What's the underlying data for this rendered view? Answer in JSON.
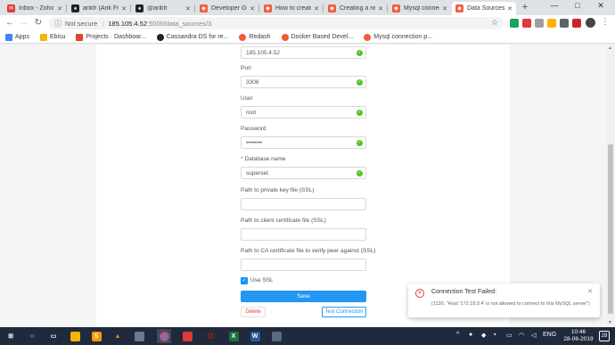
{
  "browser": {
    "tabs": [
      {
        "title": "Inbox - Zoho M",
        "icon": "mail-icon",
        "color": "#e0393b"
      },
      {
        "title": "arikfr (Arik Fra",
        "icon": "github-icon",
        "color": "#222222"
      },
      {
        "title": "@arikfr",
        "icon": "github-icon",
        "color": "#222222"
      },
      {
        "title": "Developer Gui",
        "icon": "redash-icon",
        "color": "#f25b3a"
      },
      {
        "title": "How to create",
        "icon": "redash-icon",
        "color": "#f25b3a"
      },
      {
        "title": "Creating a new",
        "icon": "redash-icon",
        "color": "#f25b3a"
      },
      {
        "title": "Mysql connect",
        "icon": "redash-icon",
        "color": "#f25b3a"
      },
      {
        "title": "Data Sources",
        "icon": "redash-icon",
        "color": "#f25b3a"
      }
    ],
    "new_tab": "+",
    "window_controls": {
      "minimize": "—",
      "maximize": "□",
      "close": "✕"
    },
    "address": {
      "security": "Not secure",
      "host": "185.105.4.52",
      "path": ":5000/data_sources/3"
    },
    "bookmarks": [
      {
        "label": "Apps",
        "icon": "apps-grid-icon",
        "color": "#4285f4"
      },
      {
        "label": "Ebisu",
        "icon": "folder-icon",
        "color": "#f4b400"
      },
      {
        "label": "Projects · Dashboar...",
        "icon": "gitlab-icon",
        "color": "#e24329"
      },
      {
        "label": "Cassandra DS for re...",
        "icon": "github-icon",
        "color": "#222222"
      },
      {
        "label": "Redash",
        "icon": "redash-icon",
        "color": "#f25b3a"
      },
      {
        "label": "Docker Based Devel...",
        "icon": "redash-icon",
        "color": "#f25b3a"
      },
      {
        "label": "Mysql connection p...",
        "icon": "redash-icon",
        "color": "#f25b3a"
      }
    ]
  },
  "form": {
    "host_value": "185.105.4.52",
    "port": {
      "label": "Port",
      "value": "3306"
    },
    "user": {
      "label": "User",
      "value": "root"
    },
    "password": {
      "label": "Password",
      "value": "••••••••"
    },
    "database": {
      "label": "Database name",
      "required_mark": "*",
      "value": "superset"
    },
    "ssl_key": {
      "label": "Path to private key file (SSL)",
      "value": ""
    },
    "ssl_cert": {
      "label": "Path to client certificate file (SSL)",
      "value": ""
    },
    "ssl_ca": {
      "label": "Path to CA certificate file to verify peer against (SSL)",
      "value": ""
    },
    "use_ssl": {
      "label": "Use SSL",
      "checked": true
    },
    "save_label": "Save",
    "delete_label": "Delete",
    "test_label": "Test Connection"
  },
  "notification": {
    "title": "Connection Test Failed:",
    "message": "(1130, \"Host '172.18.0.4' is not allowed to connect to this MySQL server\")",
    "close": "✕"
  },
  "taskbar": {
    "apps": [
      {
        "name": "windows-start-icon",
        "glyph": "⊞",
        "color": "#1f2a3c"
      },
      {
        "name": "search-icon",
        "glyph": "○",
        "color": "#1f2a3c"
      },
      {
        "name": "task-view-icon",
        "glyph": "▭",
        "color": "#1f2a3c"
      },
      {
        "name": "file-explorer-icon",
        "glyph": "",
        "color": "#f4b400"
      },
      {
        "name": "sublime-text-icon",
        "glyph": "S",
        "color": "#ff9800"
      },
      {
        "name": "vlc-icon",
        "glyph": "▲",
        "color": "#ff8800"
      },
      {
        "name": "app-icon",
        "glyph": "",
        "color": "#3a4a60"
      },
      {
        "name": "chrome-icon",
        "glyph": "●",
        "color": "#4285f4"
      },
      {
        "name": "app-red-icon",
        "glyph": "",
        "color": "#e0393b"
      },
      {
        "name": "opera-icon",
        "glyph": "O",
        "color": "#cc0f16"
      },
      {
        "name": "excel-icon",
        "glyph": "X",
        "color": "#1d6f42"
      },
      {
        "name": "word-icon",
        "glyph": "W",
        "color": "#2b579a"
      },
      {
        "name": "terminal-icon",
        "glyph": "▭",
        "color": "#3a4a60"
      }
    ],
    "language": "ENG",
    "time": "10:46",
    "date": "28-06-2019",
    "notification_count": "28"
  }
}
